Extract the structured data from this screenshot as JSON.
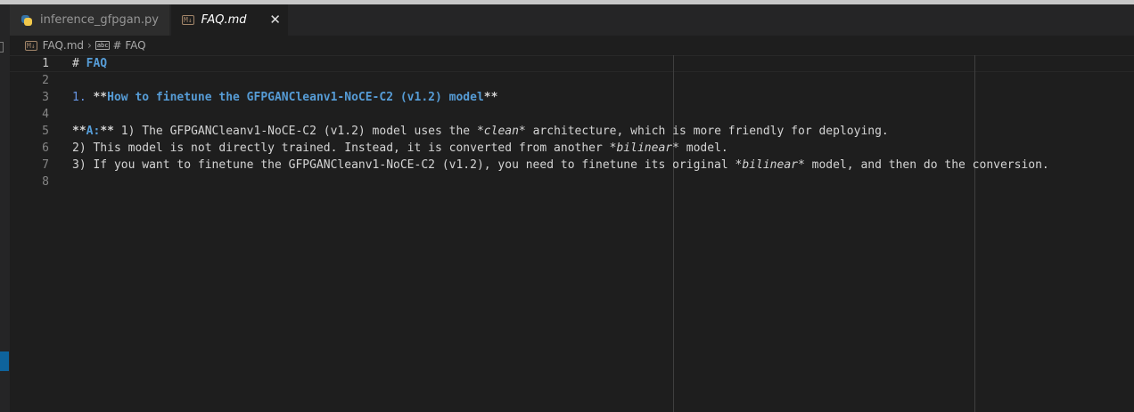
{
  "tabs": [
    {
      "label": "inference_gfpgan.py",
      "icon": "python-icon",
      "active": false
    },
    {
      "label": "FAQ.md",
      "icon": "markdown-icon",
      "active": true
    }
  ],
  "breadcrumb": {
    "file": "FAQ.md",
    "symbol": "# FAQ"
  },
  "icons": {
    "markdown": "M↓",
    "abc": "abc",
    "close": "✕",
    "separator": "›"
  },
  "colors": {
    "background": "#1e1e1e",
    "heading": "#569cd6",
    "text": "#d4d4d4",
    "line_number": "#858585"
  },
  "editor": {
    "lines": [
      {
        "num": "1",
        "segs": [
          {
            "t": "# ",
            "c": "plain"
          },
          {
            "t": "FAQ",
            "c": "heading"
          }
        ]
      },
      {
        "num": "2",
        "segs": []
      },
      {
        "num": "3",
        "segs": [
          {
            "t": "1. ",
            "c": "num"
          },
          {
            "t": "**",
            "c": "boldmark"
          },
          {
            "t": "How to finetune the GFPGANCleanv1-NoCE-C2 (v1.2) model",
            "c": "heading"
          },
          {
            "t": "**",
            "c": "boldmark"
          }
        ]
      },
      {
        "num": "4",
        "segs": []
      },
      {
        "num": "5",
        "segs": [
          {
            "t": "**",
            "c": "boldmark"
          },
          {
            "t": "A:",
            "c": "heading"
          },
          {
            "t": "** ",
            "c": "boldmark"
          },
          {
            "t": "1) The GFPGANCleanv1-NoCE-C2 (v1.2) model uses the ",
            "c": "plain"
          },
          {
            "t": "*clean*",
            "c": "em"
          },
          {
            "t": " architecture, which is more friendly for deploying.",
            "c": "plain"
          }
        ]
      },
      {
        "num": "6",
        "segs": [
          {
            "t": "2) This model is not directly trained. Instead, it is converted from another ",
            "c": "plain"
          },
          {
            "t": "*bilinear*",
            "c": "em"
          },
          {
            "t": " model.",
            "c": "plain"
          }
        ]
      },
      {
        "num": "7",
        "segs": [
          {
            "t": "3) If you want to finetune the GFPGANCleanv1-NoCE-C2 (v1.2), you need to finetune its original ",
            "c": "plain"
          },
          {
            "t": "*bilinear*",
            "c": "em"
          },
          {
            "t": " model, and then do the conversion.",
            "c": "plain"
          }
        ]
      },
      {
        "num": "8",
        "segs": []
      }
    ]
  }
}
